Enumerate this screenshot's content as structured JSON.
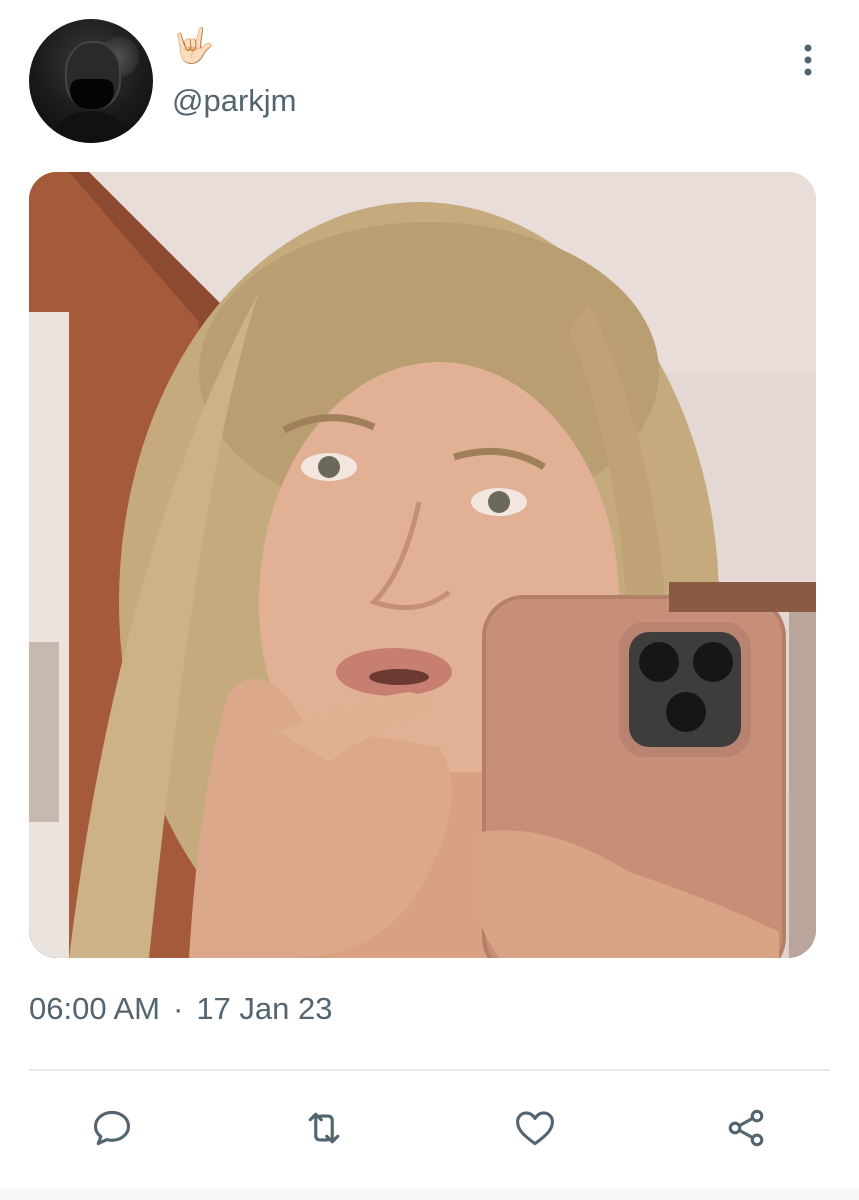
{
  "tweet": {
    "display_name": "🤟🏻",
    "handle": "@parkjm",
    "time": "06:00 AM",
    "separator": "·",
    "date": "17 Jan 23"
  },
  "icons": {
    "more": "more-vertical-icon",
    "reply": "reply-icon",
    "retweet": "retweet-icon",
    "like": "heart-icon",
    "share": "share-icon"
  },
  "colors": {
    "secondary_text": "#536471",
    "divider": "#e6e9ec",
    "background": "#ffffff"
  }
}
